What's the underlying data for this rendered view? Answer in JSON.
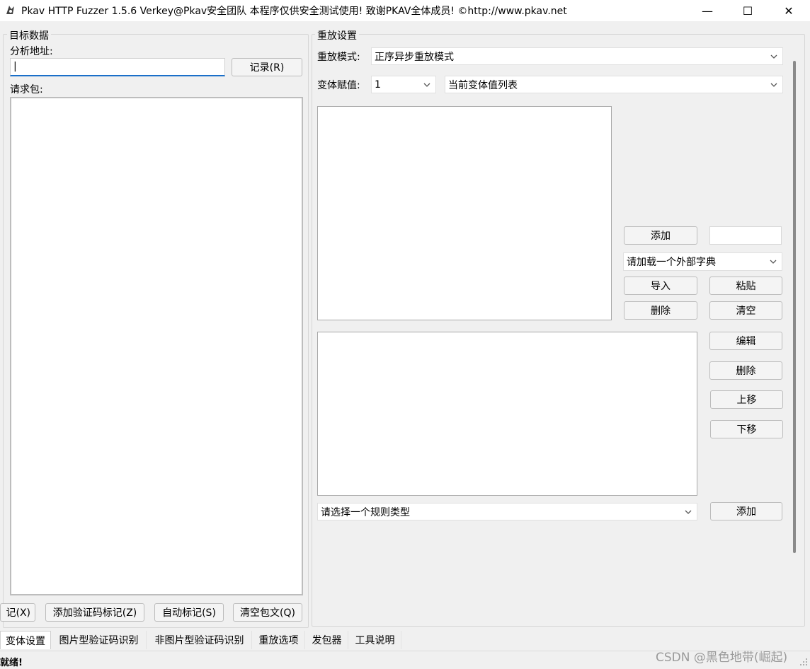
{
  "window": {
    "title": "Pkav HTTP Fuzzer 1.5.6  Verkey@Pkav安全团队  本程序仅供安全测试使用!  致谢PKAV全体成员! ©http://www.pkav.net",
    "minimize_glyph": "—",
    "maximize_glyph": "☐",
    "close_glyph": "✕"
  },
  "target": {
    "legend": "目标数据",
    "address_label": "分析地址:",
    "address_value": "|",
    "record_button": "记录(R)",
    "request_label": "请求包:",
    "bottom_buttons": [
      "记(X)",
      "添加验证码标记(Z)",
      "自动标记(S)",
      "清空包文(Q)"
    ]
  },
  "replay": {
    "legend": "重放设置",
    "mode_label": "重放模式:",
    "mode_value": "正序异步重放模式",
    "var_label": "变体赋值:",
    "var_value": "1",
    "var_list_value": "当前变体值列表",
    "add_button": "添加",
    "dict_combo": "请加载一个外部字典",
    "import_button": "导入",
    "paste_button": "粘贴",
    "delete_button": "删除",
    "clear_button": "清空",
    "edit_button": "编辑",
    "delete_button_2": "删除",
    "move_up_button": "上移",
    "move_down_button": "下移",
    "rule_combo": "请选择一个规则类型",
    "rule_add_button": "添加"
  },
  "tabs": [
    "变体设置",
    "图片型验证码识别",
    "非图片型验证码识别",
    "重放选项",
    "发包器",
    "工具说明"
  ],
  "status": {
    "text": "就绪!",
    "watermark": "CSDN @黑色地带(崛起)"
  }
}
